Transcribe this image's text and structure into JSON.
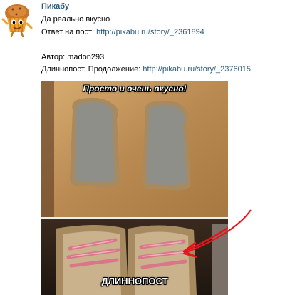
{
  "post": {
    "author": "Пикабу",
    "lines": {
      "l1": "Да реально вкусно",
      "l2_label": "Ответ на пост: ",
      "l2_link": "http://pikabu.ru/story/_2361894",
      "l3_label": "Автор: madon293",
      "l4_label": "Длиннопост. Продолжение: ",
      "l4_link": "http://pikabu.ru/story/_2376015"
    },
    "image": {
      "caption_top": "Просто и очень вкусно!",
      "caption_bottom": "ДЛИННОПОСТ"
    }
  },
  "colors": {
    "link": "#2b587a",
    "annotation_arrow": "#e8141c"
  },
  "icons": {
    "avatar": "pikabu-cupcake-mascot-icon"
  }
}
